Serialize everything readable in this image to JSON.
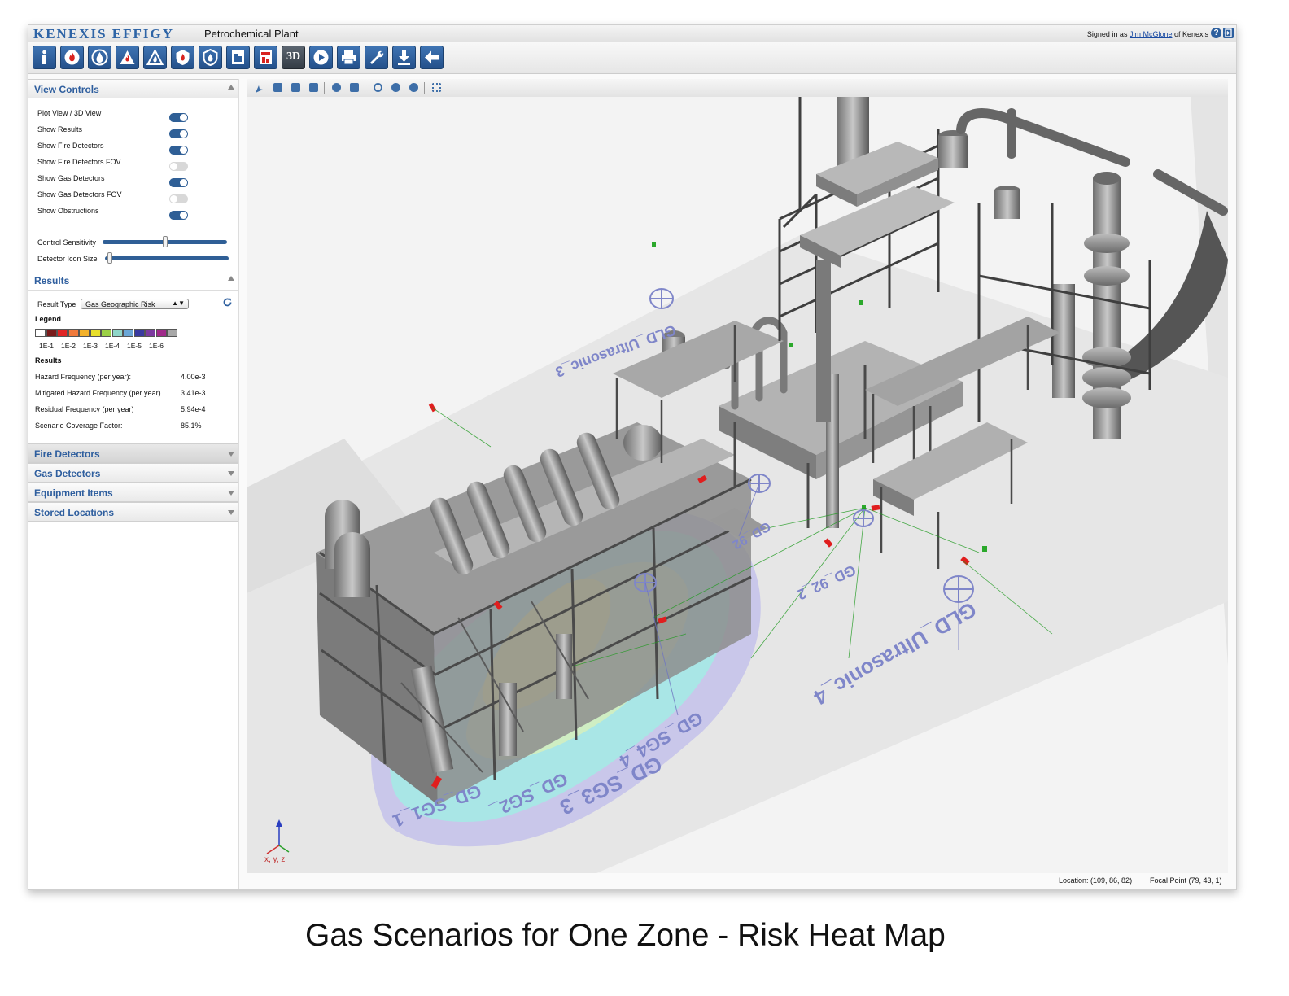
{
  "header": {
    "brand": "KENEXIS EFFIGY",
    "plant_name": "Petrochemical Plant",
    "signed_in_prefix": "Signed in as ",
    "user_name": "Jim McGlone",
    "signed_in_suffix": " of Kenexis",
    "help_icon": "?"
  },
  "toolbar": {
    "buttons": [
      {
        "name": "info-icon"
      },
      {
        "name": "fire-icon"
      },
      {
        "name": "gas-drop-icon"
      },
      {
        "name": "flame-warning-icon"
      },
      {
        "name": "flame-outline-icon"
      },
      {
        "name": "fire-shield-icon"
      },
      {
        "name": "gas-shield-icon"
      },
      {
        "name": "report-icon"
      },
      {
        "name": "report-red-icon"
      },
      {
        "name": "3d-view-icon",
        "label": "3D"
      },
      {
        "name": "play-icon"
      },
      {
        "name": "print-icon"
      },
      {
        "name": "wrench-icon"
      },
      {
        "name": "download-icon"
      },
      {
        "name": "back-arrow-icon"
      }
    ]
  },
  "view_controls": {
    "title": "View Controls",
    "toggles": [
      {
        "label": "Plot View / 3D View",
        "on": true
      },
      {
        "label": "Show Results",
        "on": true
      },
      {
        "label": "Show Fire Detectors",
        "on": true
      },
      {
        "label": "Show Fire Detectors FOV",
        "on": false
      },
      {
        "label": "Show Gas Detectors",
        "on": true
      },
      {
        "label": "Show Gas Detectors FOV",
        "on": false
      },
      {
        "label": "Show Obstructions",
        "on": true
      }
    ],
    "sliders": [
      {
        "label": "Control Sensitivity",
        "value": 0.5
      },
      {
        "label": "Detector Icon Size",
        "value": 0.02
      }
    ]
  },
  "results": {
    "title": "Results",
    "result_type_label": "Result Type",
    "result_type_value": "Gas Geographic Risk",
    "legend_title": "Legend",
    "legend_colors": [
      "#ffffff",
      "#7a1b1b",
      "#e02525",
      "#f07a3c",
      "#f3b12a",
      "#e8df2a",
      "#9bd046",
      "#8fd6c8",
      "#6aa6d6",
      "#3a3aa0",
      "#7d3aa0",
      "#a02a8a",
      "#a8a8a8"
    ],
    "legend_ticks": [
      "1E-1",
      "1E-2",
      "1E-3",
      "1E-4",
      "1E-5",
      "1E-6"
    ],
    "subheading": "Results",
    "metrics": [
      {
        "label": "Hazard Frequency (per year):",
        "value": "4.00e-3"
      },
      {
        "label": "Mitigated Hazard Frequency (per year)",
        "value": "3.41e-3"
      },
      {
        "label": "Residual Frequency (per year)",
        "value": "5.94e-4"
      },
      {
        "label": "Scenario Coverage Factor:",
        "value": "85.1%"
      }
    ]
  },
  "sections": [
    {
      "title": "Fire Detectors"
    },
    {
      "title": "Gas Detectors"
    },
    {
      "title": "Equipment Items"
    },
    {
      "title": "Stored Locations"
    }
  ],
  "viewport": {
    "detector_labels": [
      "GLD_Ultrasonic_3",
      "GLD_Ultrasonic_4",
      "GD_92_2",
      "GD_92",
      "GD_SG4_4",
      "GD_SG2_",
      "GD_SG1_1",
      "GD_SG3_3"
    ],
    "axis_label": "x, y, z",
    "colors": {
      "risk_outer": "#c9c7ea",
      "risk_cyan": "#a9e6e6",
      "risk_green": "#cfeec3",
      "risk_yellow": "#f3f58a",
      "detector_label": "#7f86c9"
    }
  },
  "status": {
    "location": "Location: (109, 86, 82)",
    "focal_point": "Focal Point (79, 43, 1)"
  },
  "caption": "Gas Scenarios for One Zone - Risk Heat Map"
}
